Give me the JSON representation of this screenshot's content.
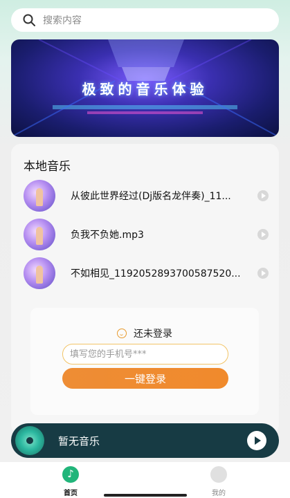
{
  "search": {
    "placeholder": "搜索内容"
  },
  "banner": {
    "title": "极致的音乐体验"
  },
  "local_music": {
    "title": "本地音乐",
    "songs": [
      {
        "name": "从彼此世界经过(Dj版名龙伴奏)_11..."
      },
      {
        "name": "负我不负她.mp3"
      },
      {
        "name": "不如相见_1192052893700587520..."
      }
    ]
  },
  "login": {
    "status": "还未登录",
    "phone_placeholder": "填写您的手机号***",
    "button_label": "一键登录"
  },
  "player": {
    "now_playing": "暂无音乐"
  },
  "tabbar": {
    "home": "首页",
    "mine": "我的"
  },
  "colors": {
    "accent_orange": "#f08a2c",
    "player_bg": "#173b44",
    "tab_active": "#21b57a"
  }
}
